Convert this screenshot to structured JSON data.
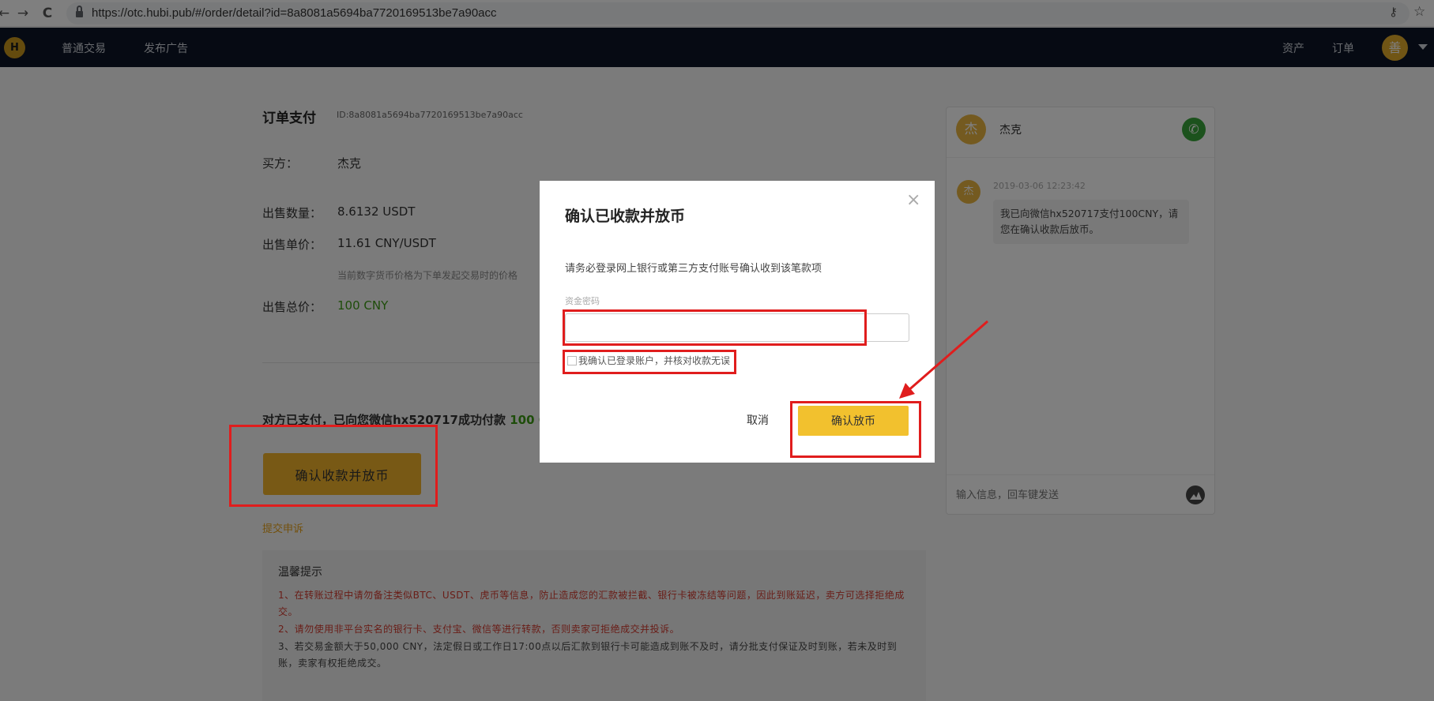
{
  "browser": {
    "back_icon": "←",
    "forward_icon": "→",
    "reload_icon": "C",
    "url": "https://otc.hubi.pub/#/order/detail?id=8a8081a5694ba7720169513be7a90acc",
    "key_icon": "⚷",
    "star_icon": "☆"
  },
  "header": {
    "logo_text": "H",
    "nav": [
      "普通交易",
      "发布广告"
    ],
    "right_nav": [
      "资产",
      "订单"
    ],
    "avatar_text": "善"
  },
  "order": {
    "title": "订单支付",
    "id": "ID:8a8081a5694ba7720169513be7a90acc",
    "buyer_label": "买方：",
    "buyer": "杰克",
    "qty_label": "出售数量：",
    "qty": "8.6132 USDT",
    "price_label": "出售单价：",
    "price": "11.61 CNY/USDT",
    "price_note": "当前数字货币价格为下单发起交易时的价格",
    "total_label": "出售总价：",
    "total": "100 CNY",
    "paid_msg": "对方已支付，已向您微信hx520717成功付款",
    "paid_amount": "100 C",
    "confirm_button": "确认收款并放币",
    "appeal_link": "提交申诉"
  },
  "tips": {
    "title": "温馨提示",
    "items": [
      "1、在转账过程中请勿备注类似BTC、USDT、虎币等信息，防止造成您的汇款被拦截、银行卡被冻结等问题，因此到账延迟，卖方可选择拒绝成交。",
      "2、请勿使用非平台实名的银行卡、支付宝、微信等进行转款，否则卖家可拒绝成交并投诉。",
      "3、若交易金额大于50,000 CNY，法定假日或工作日17:00点以后汇款到银行卡可能造成到账不及时，请分批支付保证及时到账，若未及时到账，卖家有权拒绝成交。"
    ]
  },
  "chat": {
    "avatar_text": "杰",
    "name": "杰克",
    "phone_icon": "✆",
    "msg_avatar_text": "杰",
    "msg_time": "2019-03-06 12:23:42",
    "msg_text": "我已向微信hx520717支付100CNY，请您在确认收款后放币。",
    "input_placeholder": "输入信息，回车键发送"
  },
  "modal": {
    "close_icon": "×",
    "title": "确认已收款并放币",
    "desc": "请务必登录网上银行或第三方支付账号确认收到该笔款项",
    "field_label": "资金密码",
    "checkbox_label": "我确认已登录账户，并核对收款无误",
    "cancel_button": "取消",
    "release_button": "确认放币"
  },
  "colors": {
    "header_bg": "#0d1526",
    "accent": "#f0b22b",
    "green": "#3c9a14",
    "annotation_red": "#e01d1d"
  }
}
